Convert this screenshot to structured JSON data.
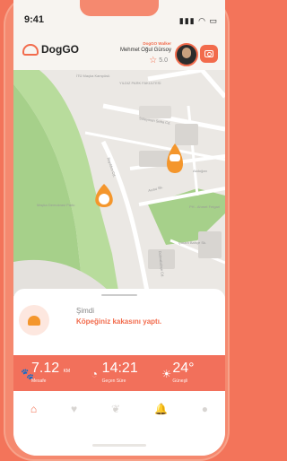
{
  "status": {
    "time": "9:41",
    "icons": "▮▮▮ ◠ ▭"
  },
  "app": {
    "name": "DogGO"
  },
  "walker": {
    "role": "DogGO Walker",
    "name": "Mehmet Oğul Gürsoy",
    "rating": "5.0"
  },
  "map": {
    "labels": [
      "İTÜ Maçka Kampüsü",
      "YILDIZ PARK FAKÜLTESİ",
      "Süleyman Seba Cd.",
      "Maçka Demokrasi Parkı",
      "Acısu Sk.",
      "Bayıldım Cd.",
      "Akdoğan",
      "PH - Ahmet Fetgari",
      "Çınarlı Bahçe Sk.",
      "Dolmabahçe Cd."
    ]
  },
  "event": {
    "when": "Şimdi",
    "text": "Köpeğiniz kakasını yaptı."
  },
  "stats": [
    {
      "icon": "paw",
      "value": "7.12",
      "unit": "KM",
      "label": "Mesafe"
    },
    {
      "icon": "clock",
      "value": "14:21",
      "label": "Geçen Süre"
    },
    {
      "icon": "sun",
      "value": "24°",
      "label": "Güneşli"
    }
  ],
  "tabs": [
    "home",
    "heart",
    "paw",
    "bell",
    "user"
  ],
  "colors": {
    "accent": "#f26b4c",
    "park": "#a6d08a",
    "poop": "#f4962c"
  }
}
